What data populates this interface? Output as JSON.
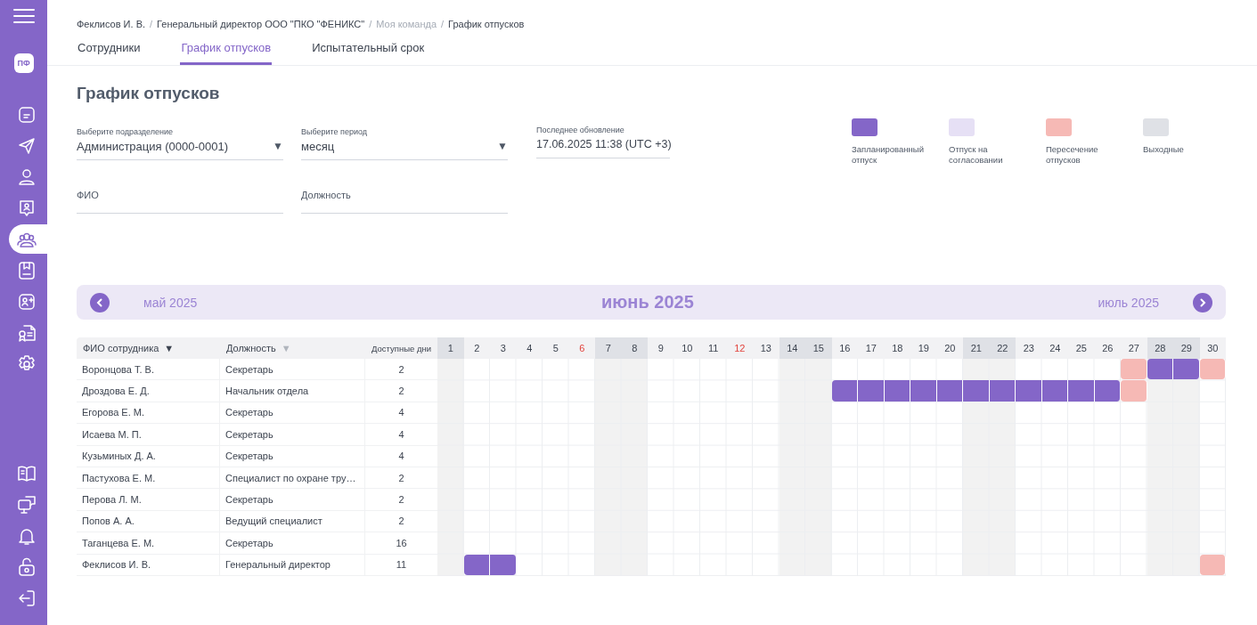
{
  "sidebar": {
    "logo": "ПФ",
    "items": [
      {
        "kind": "document",
        "selected": false
      },
      {
        "kind": "send",
        "selected": false
      },
      {
        "kind": "user",
        "selected": false
      },
      {
        "kind": "badge",
        "selected": false
      },
      {
        "kind": "team",
        "selected": true
      },
      {
        "kind": "bookmark",
        "selected": false
      },
      {
        "kind": "add-user",
        "selected": false
      },
      {
        "kind": "certificate",
        "selected": false
      },
      {
        "kind": "settings",
        "selected": false
      }
    ],
    "bottom_items": [
      {
        "kind": "book",
        "selected": false
      },
      {
        "kind": "monitor",
        "selected": false
      },
      {
        "kind": "bell",
        "selected": false
      },
      {
        "kind": "lock",
        "selected": false
      },
      {
        "kind": "logout",
        "selected": false
      }
    ]
  },
  "breadcrumbs": [
    {
      "label": "Феклисов И. В.",
      "muted": false
    },
    {
      "label": "Генеральный директор ООО \"ПКО \"ФЕНИКС\"",
      "muted": false
    },
    {
      "label": "Моя команда",
      "muted": true
    },
    {
      "label": "График отпусков",
      "muted": false
    }
  ],
  "breadcrumb_separator": "/",
  "tabs": [
    {
      "label": "Сотрудники",
      "selected": false
    },
    {
      "label": "График отпусков",
      "selected": true
    },
    {
      "label": "Испытательный срок",
      "selected": false
    }
  ],
  "title": "График отпусков",
  "filters": {
    "department": {
      "label": "Выберите подразделение",
      "value": "Администрация (0000-0001)",
      "arrow": "▼"
    },
    "period": {
      "label": "Выберите период",
      "value": "месяц",
      "arrow": "▼"
    },
    "updated": {
      "label": "Последнее обновление",
      "value": "17.06.2025 11:38 (UTC +3)"
    },
    "name": {
      "placeholder": "ФИО"
    },
    "position": {
      "placeholder": "Должность"
    }
  },
  "legend": [
    {
      "kind": "planned",
      "label": "Запланированный отпуск",
      "color": "#8466c8"
    },
    {
      "kind": "pending",
      "label": "Отпуск на согласовании",
      "color": "#e6e0f5"
    },
    {
      "kind": "overlap",
      "label": "Пересечение отпусков",
      "color": "#f6b9b5"
    },
    {
      "kind": "weekend",
      "label": "Выходные",
      "color": "#dfe1e6"
    }
  ],
  "calendar": {
    "prev": "май 2025",
    "current": "июнь 2025",
    "next": "июль 2025"
  },
  "table": {
    "columns": [
      {
        "label": "ФИО сотрудника",
        "sort": "▼",
        "sort_active": true
      },
      {
        "label": "Должность",
        "sort": "▼",
        "sort_active": false
      },
      {
        "label": "Доступные дни"
      }
    ],
    "days": [
      {
        "label": "1",
        "kind": "weekend"
      },
      {
        "label": "2",
        "kind": "workday"
      },
      {
        "label": "3",
        "kind": "workday"
      },
      {
        "label": "4",
        "kind": "workday"
      },
      {
        "label": "5",
        "kind": "workday"
      },
      {
        "label": "6",
        "kind": "holiday"
      },
      {
        "label": "7",
        "kind": "weekend"
      },
      {
        "label": "8",
        "kind": "weekend"
      },
      {
        "label": "9",
        "kind": "workday"
      },
      {
        "label": "10",
        "kind": "workday"
      },
      {
        "label": "11",
        "kind": "workday"
      },
      {
        "label": "12",
        "kind": "holiday"
      },
      {
        "label": "13",
        "kind": "workday"
      },
      {
        "label": "14",
        "kind": "weekend"
      },
      {
        "label": "15",
        "kind": "weekend"
      },
      {
        "label": "16",
        "kind": "workday"
      },
      {
        "label": "17",
        "kind": "workday"
      },
      {
        "label": "18",
        "kind": "workday"
      },
      {
        "label": "19",
        "kind": "workday"
      },
      {
        "label": "20",
        "kind": "workday"
      },
      {
        "label": "21",
        "kind": "weekend"
      },
      {
        "label": "22",
        "kind": "weekend"
      },
      {
        "label": "23",
        "kind": "workday"
      },
      {
        "label": "24",
        "kind": "workday"
      },
      {
        "label": "25",
        "kind": "workday"
      },
      {
        "label": "26",
        "kind": "workday"
      },
      {
        "label": "27",
        "kind": "workday"
      },
      {
        "label": "28",
        "kind": "weekend"
      },
      {
        "label": "29",
        "kind": "weekend"
      },
      {
        "label": "30",
        "kind": "workday"
      }
    ],
    "rows": [
      {
        "name": "Воронцова Т. В.",
        "position": "Секретарь",
        "available": "2",
        "schedule": [
          {
            "kind": "free"
          },
          {
            "kind": "free"
          },
          {
            "kind": "free"
          },
          {
            "kind": "free"
          },
          {
            "kind": "free"
          },
          {
            "kind": "free"
          },
          {
            "kind": "free"
          },
          {
            "kind": "free"
          },
          {
            "kind": "free"
          },
          {
            "kind": "free"
          },
          {
            "kind": "free"
          },
          {
            "kind": "free"
          },
          {
            "kind": "free"
          },
          {
            "kind": "free"
          },
          {
            "kind": "free"
          },
          {
            "kind": "free"
          },
          {
            "kind": "free"
          },
          {
            "kind": "free"
          },
          {
            "kind": "free"
          },
          {
            "kind": "free"
          },
          {
            "kind": "free"
          },
          {
            "kind": "free"
          },
          {
            "kind": "free"
          },
          {
            "kind": "free"
          },
          {
            "kind": "free"
          },
          {
            "kind": "free"
          },
          {
            "kind": "overlap"
          },
          {
            "kind": "planned"
          },
          {
            "kind": "planned"
          },
          {
            "kind": "overlap"
          }
        ]
      },
      {
        "name": "Дроздова Е. Д.",
        "position": "Начальник отдела",
        "available": "2",
        "schedule": [
          {
            "kind": "free"
          },
          {
            "kind": "free"
          },
          {
            "kind": "free"
          },
          {
            "kind": "free"
          },
          {
            "kind": "free"
          },
          {
            "kind": "free"
          },
          {
            "kind": "free"
          },
          {
            "kind": "free"
          },
          {
            "kind": "free"
          },
          {
            "kind": "free"
          },
          {
            "kind": "free"
          },
          {
            "kind": "free"
          },
          {
            "kind": "free"
          },
          {
            "kind": "free"
          },
          {
            "kind": "free"
          },
          {
            "kind": "planned"
          },
          {
            "kind": "planned"
          },
          {
            "kind": "planned"
          },
          {
            "kind": "planned"
          },
          {
            "kind": "planned"
          },
          {
            "kind": "planned"
          },
          {
            "kind": "planned"
          },
          {
            "kind": "planned"
          },
          {
            "kind": "planned"
          },
          {
            "kind": "planned"
          },
          {
            "kind": "planned"
          },
          {
            "kind": "overlap"
          },
          {
            "kind": "free"
          },
          {
            "kind": "free"
          },
          {
            "kind": "free"
          }
        ]
      },
      {
        "name": "Егорова Е. М.",
        "position": "Секретарь",
        "available": "4"
      },
      {
        "name": "Исаева М. П.",
        "position": "Секретарь",
        "available": "4"
      },
      {
        "name": "Кузьминых Д. А.",
        "position": "Секретарь",
        "available": "4"
      },
      {
        "name": "Пастухова Е. М.",
        "position": "Специалист по охране тру…",
        "available": "2"
      },
      {
        "name": "Перова Л. М.",
        "position": "Секретарь",
        "available": "2"
      },
      {
        "name": "Попов А. А.",
        "position": "Ведущий специалист",
        "available": "2"
      },
      {
        "name": "Таганцева Е. М.",
        "position": "Секретарь",
        "available": "16"
      },
      {
        "name": "Феклисов И. В.",
        "position": "Генеральный директор",
        "available": "11",
        "schedule": [
          {
            "kind": "free"
          },
          {
            "kind": "planned"
          },
          {
            "kind": "planned"
          },
          {
            "kind": "free"
          },
          {
            "kind": "free"
          },
          {
            "kind": "free"
          },
          {
            "kind": "free"
          },
          {
            "kind": "free"
          },
          {
            "kind": "free"
          },
          {
            "kind": "free"
          },
          {
            "kind": "free"
          },
          {
            "kind": "free"
          },
          {
            "kind": "free"
          },
          {
            "kind": "free"
          },
          {
            "kind": "free"
          },
          {
            "kind": "free"
          },
          {
            "kind": "free"
          },
          {
            "kind": "free"
          },
          {
            "kind": "free"
          },
          {
            "kind": "free"
          },
          {
            "kind": "free"
          },
          {
            "kind": "free"
          },
          {
            "kind": "free"
          },
          {
            "kind": "free"
          },
          {
            "kind": "free"
          },
          {
            "kind": "free"
          },
          {
            "kind": "free"
          },
          {
            "kind": "free"
          },
          {
            "kind": "free"
          },
          {
            "kind": "overlap"
          }
        ]
      }
    ]
  }
}
